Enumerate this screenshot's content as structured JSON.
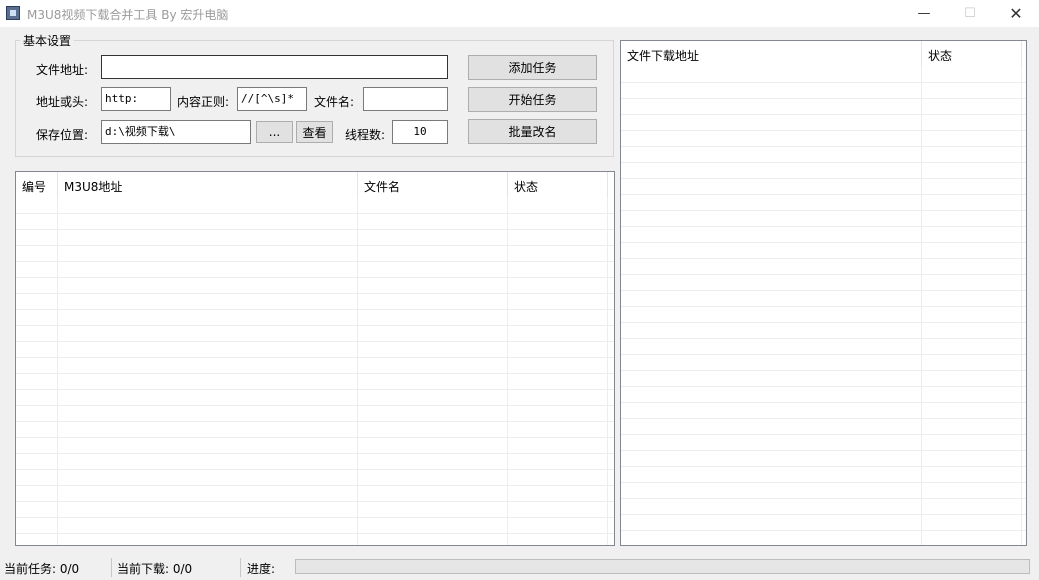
{
  "window": {
    "title": "M3U8视频下载合并工具 By 宏升电脑",
    "minimize_glyph": "—",
    "maximize_glyph": "☐",
    "close_glyph": "✕",
    "icon": "app-icon"
  },
  "settings": {
    "group_title": "基本设置",
    "file_address_label": "文件地址:",
    "file_address_value": "",
    "url_prefix_label": "地址或头:",
    "url_prefix_value": "http:",
    "regex_label": "内容正则:",
    "regex_value": "//[^\\s]*",
    "filename_label": "文件名:",
    "filename_value": "",
    "save_location_label": "保存位置:",
    "save_location_value": "d:\\视频下载\\",
    "browse_label": "...",
    "view_label": "查看",
    "threads_label": "线程数:",
    "threads_value": "10",
    "add_task_label": "添加任务",
    "start_task_label": "开始任务",
    "batch_rename_label": "批量改名"
  },
  "task_list": {
    "columns": [
      "编号",
      "M3U8地址",
      "文件名",
      "状态"
    ],
    "rows": []
  },
  "download_list": {
    "columns": [
      "文件下载地址",
      "状态"
    ],
    "rows": []
  },
  "statusbar": {
    "current_task": "当前任务: 0/0",
    "current_download": "当前下载: 0/0",
    "progress_label": "进度:",
    "progress_fraction": 0
  },
  "colors": {
    "window_bg": "#f0f0f0",
    "button_bg": "#e1e1e1",
    "button_border": "#adadad"
  }
}
